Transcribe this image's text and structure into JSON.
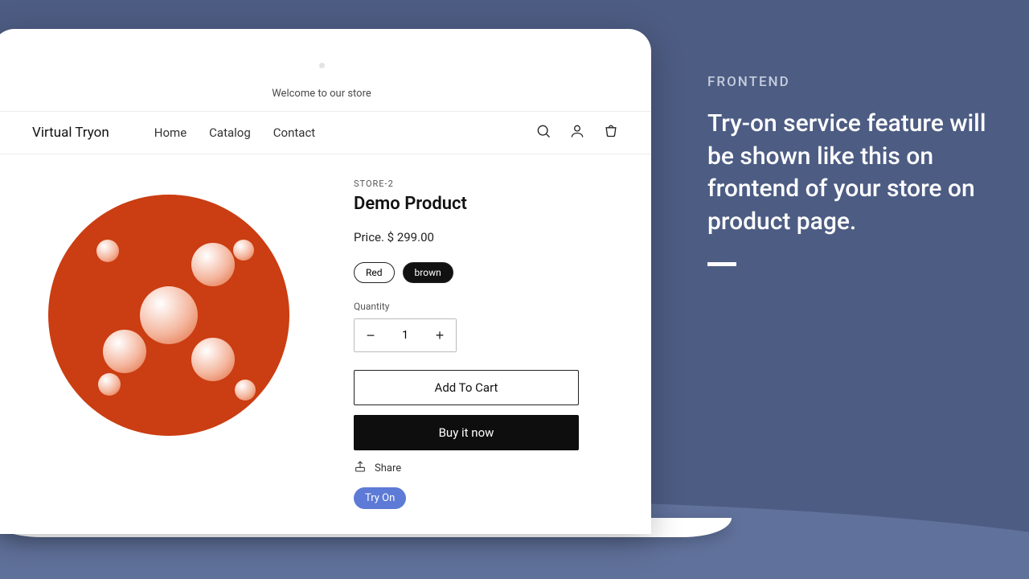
{
  "marketing": {
    "kicker": "FRONTEND",
    "headline": "Try-on service feature will be shown like this on frontend of your store on product page."
  },
  "store": {
    "announcement": "Welcome to our store",
    "brand": "Virtual Tryon",
    "nav": {
      "home": "Home",
      "catalog": "Catalog",
      "contact": "Contact"
    }
  },
  "product": {
    "vendor": "STORE-2",
    "title": "Demo Product",
    "price_label": "Price. $ 299.00",
    "variants": {
      "red": "Red",
      "brown": "brown"
    },
    "quantity_label": "Quantity",
    "quantity_value": "1",
    "add_to_cart": "Add To Cart",
    "buy_now": "Buy it now",
    "share": "Share",
    "tryon": "Try On"
  }
}
